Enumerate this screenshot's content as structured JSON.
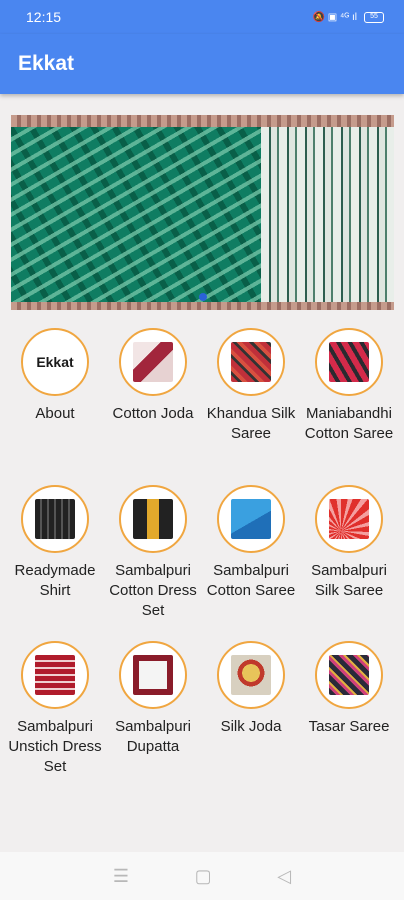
{
  "status": {
    "time": "12:15",
    "icons": "🔕 ▣ ⁴ᴳ ıl",
    "battery": "55"
  },
  "app": {
    "title": "Ekkat"
  },
  "categories": [
    {
      "label": "About",
      "icon": "ekkat-logo",
      "logo_text": "Ekkat"
    },
    {
      "label": "Cotton Joda",
      "icon": "cotton-joda-thumbnail"
    },
    {
      "label": "Khandua Silk Saree",
      "icon": "khandua-saree-thumbnail"
    },
    {
      "label": "Maniabandhi Cotton Saree",
      "icon": "maniabandhi-saree-thumbnail"
    },
    {
      "label": "Readymade Shirt",
      "icon": "shirt-thumbnail"
    },
    {
      "label": "Sambalpuri Cotton Dress Set",
      "icon": "dress-set-thumbnail"
    },
    {
      "label": "Sambalpuri Cotton Saree",
      "icon": "cotton-saree-thumbnail"
    },
    {
      "label": "Sambalpuri Silk Saree",
      "icon": "silk-saree-thumbnail"
    },
    {
      "label": "Sambalpuri Unstich Dress Set",
      "icon": "unstich-dress-thumbnail"
    },
    {
      "label": "Sambalpuri Dupatta",
      "icon": "dupatta-thumbnail"
    },
    {
      "label": "Silk Joda",
      "icon": "silk-joda-thumbnail"
    },
    {
      "label": "Tasar Saree",
      "icon": "tasar-saree-thumbnail"
    }
  ],
  "nav": {
    "recents": "☰",
    "home": "▢",
    "back": "◁"
  },
  "colors": {
    "primary": "#4a86f0",
    "circle_border": "#f0a640"
  }
}
